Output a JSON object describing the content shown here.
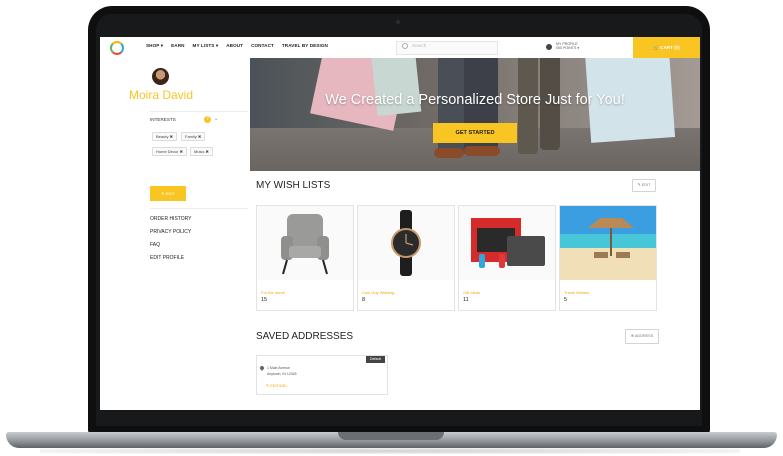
{
  "nav": {
    "links": [
      "SHOP ▾",
      "EARN",
      "MY LISTS ▾",
      "ABOUT",
      "CONTACT",
      "TRAVEL BY DESIGN"
    ],
    "search_placeholder": "Search",
    "account_line1": "MY PROFILE",
    "account_line2": "000 POINTS ▾",
    "cart_label": "🛒 CART (0)"
  },
  "sidebar": {
    "user_name": "Moira David",
    "interests_label": "INTERESTS",
    "help_badge": "?",
    "interests": [
      "Beauty ✖",
      "Family ✖",
      "Home Decor ✖",
      "Music ✖"
    ],
    "edit_button": "✎ EDIT",
    "links": [
      "ORDER HISTORY",
      "PRIVACY POLICY",
      "FAQ",
      "EDIT PROFILE"
    ]
  },
  "hero": {
    "title": "We Created a Personalized Store Just for You!",
    "cta": "GET STARTED"
  },
  "wishlists": {
    "title": "MY WISH LISTS",
    "edit_button": "✎ EDIT",
    "items": [
      {
        "name": "For the home",
        "count": "15",
        "icon": "armchair"
      },
      {
        "name": "Cool Guy Wishing...",
        "count": "8",
        "icon": "wristwatch"
      },
      {
        "name": "Gift Ideas",
        "count": "11",
        "icon": "game-console"
      },
      {
        "name": "Travel Wishes",
        "count": "5",
        "icon": "beach"
      }
    ]
  },
  "addresses": {
    "title": "SAVED ADDRESSES",
    "add_button": "⊕ ADDRESS",
    "cards": [
      {
        "line1": "1 Main Avenue",
        "line2": "Anytown, IN 12345",
        "badge": "Default",
        "edit": "✎ EDIT/DEL"
      }
    ]
  },
  "colors": {
    "accent": "#f9c523",
    "text": "#222222"
  }
}
